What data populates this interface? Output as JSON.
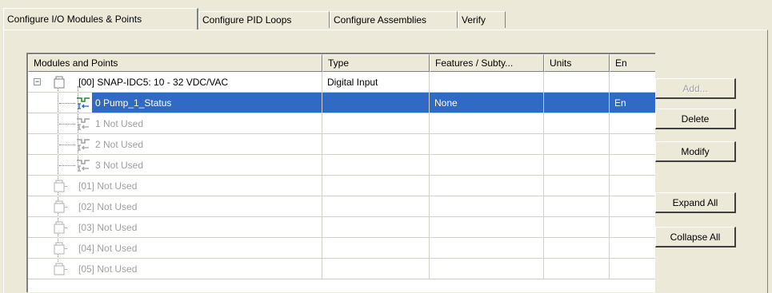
{
  "tabs": [
    {
      "label": "Configure I/O Modules & Points",
      "active": true
    },
    {
      "label": "Configure PID Loops",
      "active": false
    },
    {
      "label": "Configure Assemblies",
      "active": false
    },
    {
      "label": "Verify",
      "active": false
    }
  ],
  "list": {
    "columns": [
      "Modules and Points",
      "Type",
      "Features / Subty...",
      "Units",
      "En"
    ],
    "rows": [
      {
        "kind": "module",
        "state": "expanded",
        "name": "[00] SNAP-IDC5: 10 - 32 VDC/VAC",
        "type": "Digital Input",
        "features": "",
        "units": "",
        "en": ""
      },
      {
        "kind": "point",
        "selected": true,
        "name": "0 Pump_1_Status",
        "type": "",
        "features": "None",
        "units": "",
        "en": "En"
      },
      {
        "kind": "point",
        "disabled": true,
        "name": "1 Not Used"
      },
      {
        "kind": "point",
        "disabled": true,
        "name": "2 Not Used"
      },
      {
        "kind": "point",
        "disabled": true,
        "name": "3 Not Used"
      },
      {
        "kind": "module",
        "disabled": true,
        "name": "[01] Not Used"
      },
      {
        "kind": "module",
        "disabled": true,
        "name": "[02] Not Used"
      },
      {
        "kind": "module",
        "disabled": true,
        "name": "[03] Not Used"
      },
      {
        "kind": "module",
        "disabled": true,
        "name": "[04] Not Used"
      },
      {
        "kind": "module",
        "disabled": true,
        "name": "[05] Not Used"
      }
    ]
  },
  "buttons": {
    "add": {
      "label": "Add...",
      "enabled": false
    },
    "delete": {
      "label": "Delete",
      "enabled": true
    },
    "modify": {
      "label": "Modify",
      "enabled": true
    },
    "expand_all": {
      "label": "Expand All",
      "enabled": true
    },
    "collapse_all": {
      "label": "Collapse All",
      "enabled": true
    }
  },
  "colors": {
    "selection": "#316ac5",
    "window": "#ece9d8"
  },
  "icons": {
    "module": "module-icon",
    "point": "digital-input-point-icon",
    "expander": "collapse-icon"
  }
}
